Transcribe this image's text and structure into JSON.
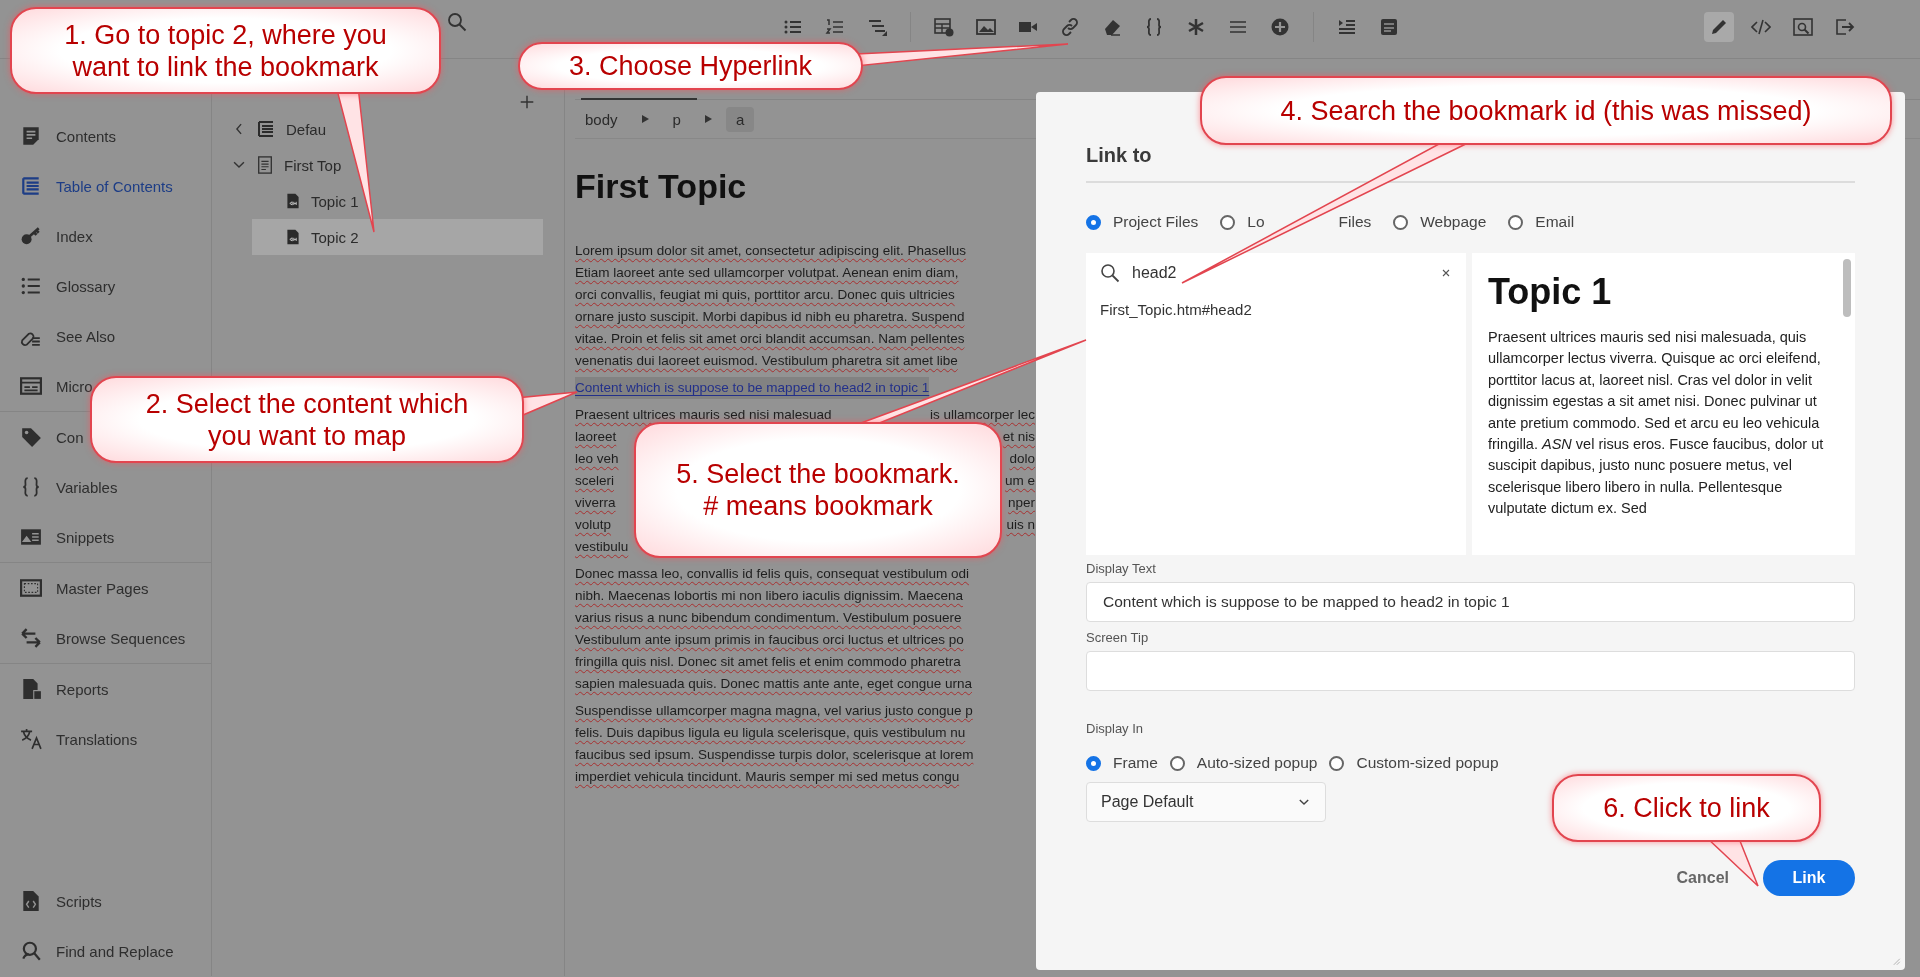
{
  "toolbar": {
    "modes": [
      {
        "selected": true
      },
      {
        "selected": false
      },
      {
        "selected": false
      }
    ]
  },
  "nav": {
    "groups": [
      {
        "items": [
          {
            "label": "Contents",
            "selected": false
          },
          {
            "label": "Table of Contents",
            "selected": true
          },
          {
            "label": "Index",
            "selected": false
          },
          {
            "label": "Glossary",
            "selected": false
          },
          {
            "label": "See Also",
            "selected": false
          },
          {
            "label": "Micro",
            "selected": false
          }
        ]
      },
      {
        "items": [
          {
            "label": "Con",
            "selected": false
          },
          {
            "label": "Variables",
            "selected": false
          },
          {
            "label": "Snippets",
            "selected": false
          }
        ]
      },
      {
        "items": [
          {
            "label": "Master Pages",
            "selected": false
          },
          {
            "label": "Browse Sequences",
            "selected": false
          }
        ]
      },
      {
        "items": [
          {
            "label": "Reports",
            "selected": false
          },
          {
            "label": "Translations",
            "selected": false
          }
        ]
      }
    ],
    "bottom": [
      {
        "label": "Scripts",
        "selected": false
      },
      {
        "label": "Find and Replace",
        "selected": false
      }
    ]
  },
  "toc": {
    "root": "Defau",
    "items": [
      {
        "label": "First Top",
        "expanded": true,
        "children": [
          {
            "label": "Topic 1",
            "selected": false
          },
          {
            "label": "Topic 2",
            "selected": true
          }
        ]
      }
    ]
  },
  "editor": {
    "breadcrumb": [
      {
        "label": "body",
        "selected": false
      },
      {
        "label": "p",
        "selected": false
      },
      {
        "label": "a",
        "selected": true
      }
    ],
    "title": "First Topic",
    "paragraphs": [
      {
        "kind": "text",
        "lines": [
          {
            "text": "Lorem ipsum dolor sit amet, consectetur adipiscing elit. Phasellus"
          },
          {
            "text": "Etiam laoreet ante sed ullamcorper volutpat. Aenean enim diam,"
          },
          {
            "text": "orci convallis, feugiat mi quis, porttitor arcu. Donec quis ultricies"
          },
          {
            "text": "ornare justo suscipit. Morbi dapibus id nibh eu pharetra. Suspend"
          },
          {
            "text": "vitae. Proin et felis sit amet orci blandit accumsan. Nam pellentes"
          },
          {
            "text": "venenatis dui laoreet euismod. Vestibulum pharetra sit amet libe"
          }
        ]
      },
      {
        "kind": "link",
        "lines": [
          {
            "text": "Content which is suppose to be mapped to head2 in topic 1"
          }
        ]
      },
      {
        "kind": "text",
        "lines": [
          {
            "text": "Praesent ultrices mauris sed nisi malesuad",
            "tail": "is ullamcorper lec"
          },
          {
            "text": "laoreet",
            "tail": "et nis"
          },
          {
            "text": "leo veh",
            "tail": "dolo"
          },
          {
            "text": "sceleri",
            "tail": "um e"
          },
          {
            "text": "viverra",
            "tail": "nper"
          },
          {
            "text": "volutp",
            "tail": "uis n"
          },
          {
            "text": "vestibulu"
          }
        ]
      },
      {
        "kind": "text",
        "lines": [
          {
            "text": "Donec massa leo, convallis id felis quis, consequat vestibulum odi"
          },
          {
            "text": "nibh. Maecenas lobortis mi non libero iaculis dignissim. Maecena"
          },
          {
            "text": "varius risus a nunc bibendum condimentum. Vestibulum posuere"
          },
          {
            "text": "Vestibulum ante ipsum primis in faucibus orci luctus et ultrices po"
          },
          {
            "text": "fringilla quis nisl. Donec sit amet felis et enim commodo pharetra"
          },
          {
            "text": "sapien malesuada quis. Donec mattis ante ante, eget congue urna"
          }
        ]
      },
      {
        "kind": "text",
        "lines": [
          {
            "text": "Suspendisse ullamcorper magna magna, vel varius justo congue p"
          },
          {
            "text": "felis. Duis dapibus ligula eu ligula scelerisque, quis vestibulum nu"
          },
          {
            "text": "faucibus sed ipsum. Suspendisse turpis dolor, scelerisque at lorem"
          },
          {
            "text": "imperdiet vehicula tincidunt. Mauris semper mi sed metus congu"
          }
        ]
      }
    ]
  },
  "dialog": {
    "title": "Link to",
    "targets": [
      {
        "label": "Project Files",
        "selected": true
      },
      {
        "label": "Lo",
        "after": "Files",
        "selected": false
      },
      {
        "label": "Webpage",
        "selected": false
      },
      {
        "label": "Email",
        "selected": false
      }
    ],
    "search": {
      "value": "head2"
    },
    "results": [
      "First_Topic.htm#head2"
    ],
    "preview": {
      "title": "Topic 1",
      "text": "Praesent ultrices mauris sed nisi malesuada, quis ullamcorper lectus viverra. Quisque ac orci eleifend, porttitor lacus at, laoreet nisl. Cras vel dolor in velit dignissim egestas a sit amet nisi. Donec pulvinar ut ante pretium commodo. Sed et arcu eu leo vehicula fringilla. *ASN* vel risus eros. Fusce faucibus, dolor ut suscipit dapibus, justo nunc posuere metus, vel scelerisque libero libero in nulla. Pellentesque vulputate dictum ex. Sed"
    },
    "display_text": {
      "label": "Display Text",
      "value": "Content which is suppose to be mapped to head2 in topic 1"
    },
    "screen_tip": {
      "label": "Screen Tip"
    },
    "display_in": {
      "label": "Display In",
      "options": [
        {
          "label": "Frame",
          "selected": true
        },
        {
          "label": "Auto-sized popup",
          "selected": false
        },
        {
          "label": "Custom-sized popup",
          "selected": false
        }
      ],
      "dropdown": "Page Default"
    },
    "buttons": [
      {
        "label": "Cancel",
        "kind": "secondary"
      },
      {
        "label": "Link",
        "kind": "primary"
      }
    ]
  },
  "callouts": [
    {
      "text": "1. Go to topic 2, where you\nwant to link the bookmark"
    },
    {
      "text": "2. Select the content which\nyou want to map"
    },
    {
      "text": "3. Choose Hyperlink"
    },
    {
      "text": "4. Search the bookmark id (this was missed)"
    },
    {
      "text": "5. Select the bookmark.\n# means bookmark"
    },
    {
      "text": "6. Click to link"
    }
  ]
}
